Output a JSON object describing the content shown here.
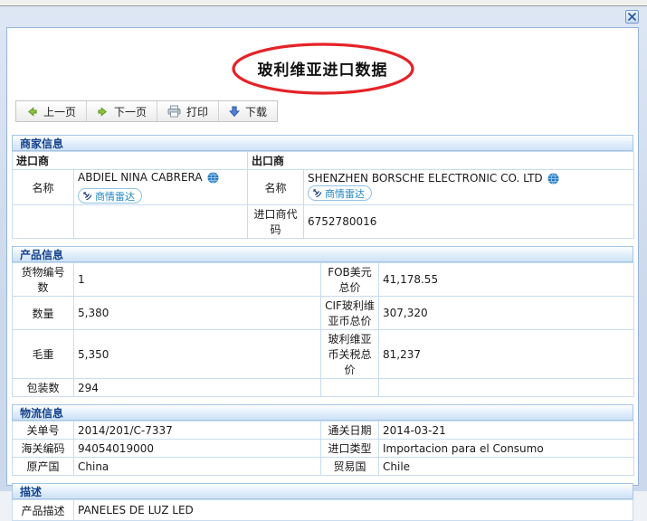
{
  "window": {
    "title": "玻利维亚进口数据"
  },
  "toolbar": {
    "prev_label": "上一页",
    "next_label": "下一页",
    "print_label": "打印",
    "download_label": "下载"
  },
  "merchant": {
    "section_title": "商家信息",
    "importer_header": "进口商",
    "exporter_header": "出口商",
    "importer_name_label": "名称",
    "importer_name": "ABDIEL NINA CABRERA",
    "exporter_name_label": "名称",
    "exporter_name": "SHENZHEN BORSCHE ELECTRONIC CO. LTD",
    "radar_label": "商情雷达",
    "importer_code_label": "进口商代码",
    "importer_code": "6752780016"
  },
  "product": {
    "section_title": "产品信息",
    "rows": [
      {
        "label1": "货物编号数",
        "value1": "1",
        "label2": "FOB美元总价",
        "value2": "41,178.55"
      },
      {
        "label1": "数量",
        "value1": "5,380",
        "label2": "CIF玻利维亚币总价",
        "value2": "307,320"
      },
      {
        "label1": "毛重",
        "value1": "5,350",
        "label2": "玻利维亚币关税总价",
        "value2": "81,237"
      },
      {
        "label1": "包装数",
        "value1": "294",
        "label2": "",
        "value2": ""
      }
    ]
  },
  "logistics": {
    "section_title": "物流信息",
    "rows": [
      {
        "label1": "关单号",
        "value1": "2014/201/C-7337",
        "label2": "通关日期",
        "value2": "2014-03-21"
      },
      {
        "label1": "海关编码",
        "value1": "94054019000",
        "label2": "进口类型",
        "value2": "Importacion para el Consumo"
      },
      {
        "label1": "原产国",
        "value1": "China",
        "label2": "贸易国",
        "value2": "Chile"
      }
    ]
  },
  "description": {
    "section_title": "描述",
    "label": "产品描述",
    "value": "PANELES DE LUZ LED"
  },
  "colors": {
    "annotation_red": "#e42328",
    "section_header_text": "#15428b",
    "table_border": "#c9dcee",
    "radar_link_blue": "#2187c0",
    "arrow_green": "#8dc63f",
    "arrow_blue": "#4f7fd9"
  }
}
